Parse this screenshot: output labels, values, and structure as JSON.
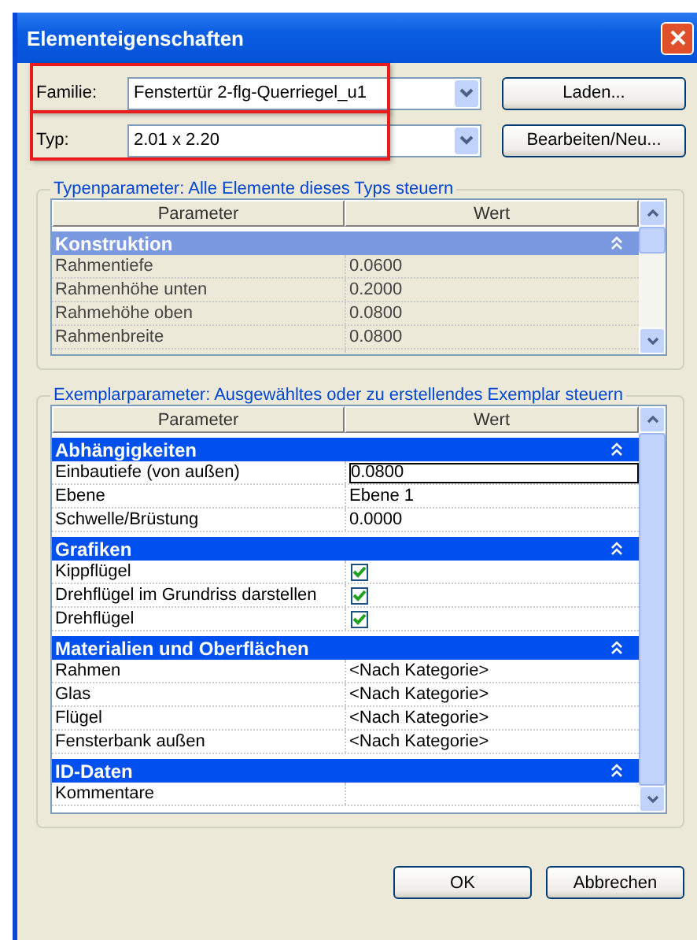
{
  "window": {
    "title": "Elementeigenschaften"
  },
  "selectors": [
    {
      "label": "Familie:",
      "value": "Fenstertür 2-flg-Querriegel_u1",
      "highlighted": true,
      "button": "Laden..."
    },
    {
      "label": "Typ:",
      "value": "2.01 x 2.20",
      "highlighted": true,
      "button": "Bearbeiten/Neu..."
    }
  ],
  "type_parameters": {
    "legend": "Typenparameter: Alle Elemente dieses Typs steuern",
    "focused": false,
    "columns": [
      "Parameter",
      "Wert"
    ],
    "groups": [
      {
        "name": "Konstruktion",
        "expanded": true,
        "rows": [
          {
            "kind": "text",
            "parameter": "Rahmentiefe",
            "value": "0.0600"
          },
          {
            "kind": "text",
            "parameter": "Rahmenhöhe unten",
            "value": "0.2000"
          },
          {
            "kind": "text",
            "parameter": "Rahmehöhe oben",
            "value": "0.0800"
          },
          {
            "kind": "text",
            "parameter": "Rahmenbreite",
            "value": "0.0800"
          }
        ]
      }
    ]
  },
  "instance_parameters": {
    "legend": "Exemplarparameter: Ausgewähltes oder zu erstellendes Exemplar steuern",
    "focused": true,
    "columns": [
      "Parameter",
      "Wert"
    ],
    "groups": [
      {
        "name": "Abhängigkeiten",
        "expanded": true,
        "rows": [
          {
            "kind": "input",
            "parameter": "Einbautiefe (von außen)",
            "value": "0.0800"
          },
          {
            "kind": "text",
            "parameter": "Ebene",
            "value": "Ebene 1"
          },
          {
            "kind": "text",
            "parameter": "Schwelle/Brüstung",
            "value": "0.0000"
          }
        ]
      },
      {
        "name": "Grafiken",
        "expanded": true,
        "rows": [
          {
            "kind": "checkbox",
            "parameter": "Kippflügel",
            "checked": true
          },
          {
            "kind": "checkbox",
            "parameter": "Drehflügel im Grundriss darstellen",
            "checked": true
          },
          {
            "kind": "checkbox",
            "parameter": "Drehflügel",
            "checked": true
          }
        ]
      },
      {
        "name": "Materialien und Oberflächen",
        "expanded": true,
        "rows": [
          {
            "kind": "text",
            "parameter": "Rahmen",
            "value": "<Nach Kategorie>"
          },
          {
            "kind": "text",
            "parameter": "Glas",
            "value": "<Nach Kategorie>"
          },
          {
            "kind": "text",
            "parameter": "Flügel",
            "value": "<Nach Kategorie>"
          },
          {
            "kind": "text",
            "parameter": "Fensterbank außen",
            "value": "<Nach Kategorie>"
          }
        ]
      },
      {
        "name": "ID-Daten",
        "expanded": true,
        "rows": [
          {
            "kind": "text",
            "parameter": "Kommentare"
          }
        ]
      }
    ]
  },
  "buttons": [
    "OK",
    "Abbrechen"
  ]
}
